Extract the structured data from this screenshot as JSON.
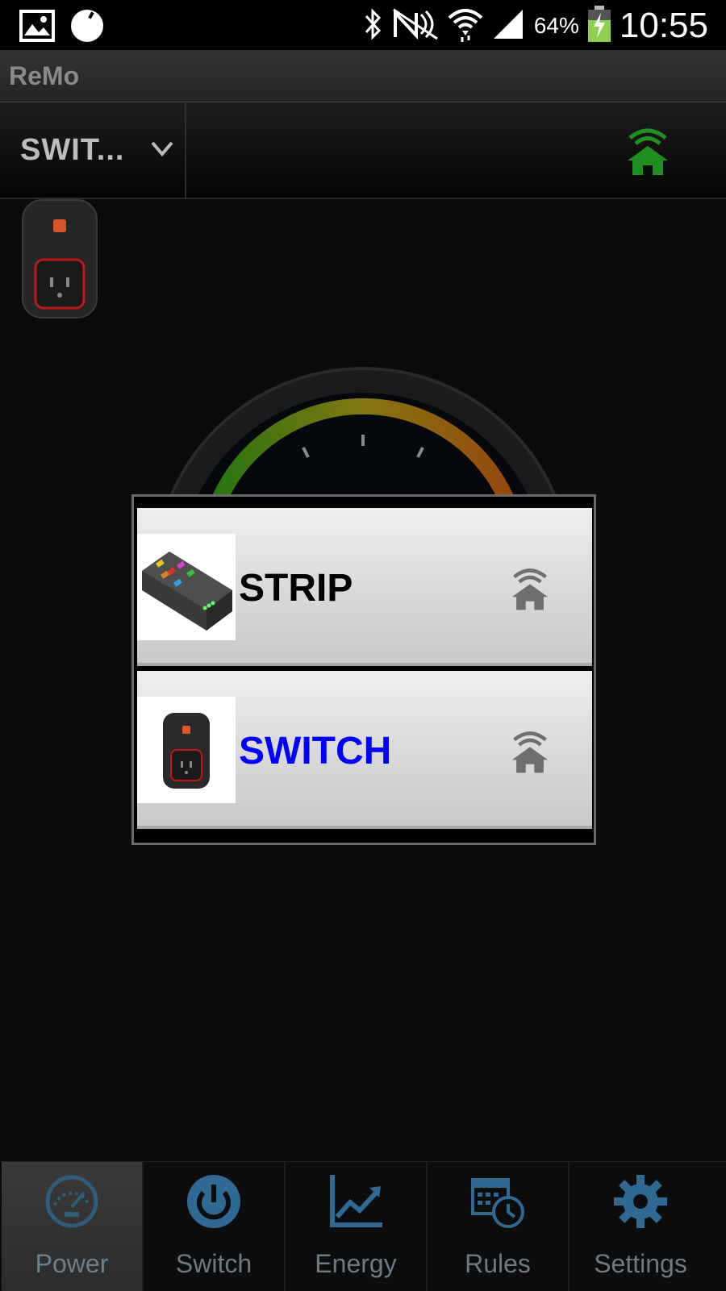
{
  "status_bar": {
    "battery_percent": "64%",
    "time": "10:55",
    "icons": [
      "gallery-icon",
      "circle-notification-icon",
      "bluetooth-icon",
      "nfc-icon",
      "wifi-icon",
      "signal-icon",
      "battery-charging-icon"
    ]
  },
  "app": {
    "title": "ReMo"
  },
  "device_bar": {
    "selected_device": "SWIT...",
    "connection_icon": "home-wifi-icon",
    "connection_color": "#1f8f1f"
  },
  "dialog": {
    "items": [
      {
        "label": "STRIP",
        "color": "#000000",
        "image": "power-strip-image",
        "icon": "home-wifi-icon"
      },
      {
        "label": "SWITCH",
        "color": "#0000ff",
        "image": "smart-switch-image",
        "icon": "home-wifi-icon"
      }
    ]
  },
  "tabs": [
    {
      "label": "Power",
      "icon": "speedometer-icon",
      "active": true
    },
    {
      "label": "Switch",
      "icon": "power-icon",
      "active": false
    },
    {
      "label": "Energy",
      "icon": "chart-icon",
      "active": false
    },
    {
      "label": "Rules",
      "icon": "calendar-clock-icon",
      "active": false
    },
    {
      "label": "Settings",
      "icon": "gear-icon",
      "active": false
    }
  ]
}
